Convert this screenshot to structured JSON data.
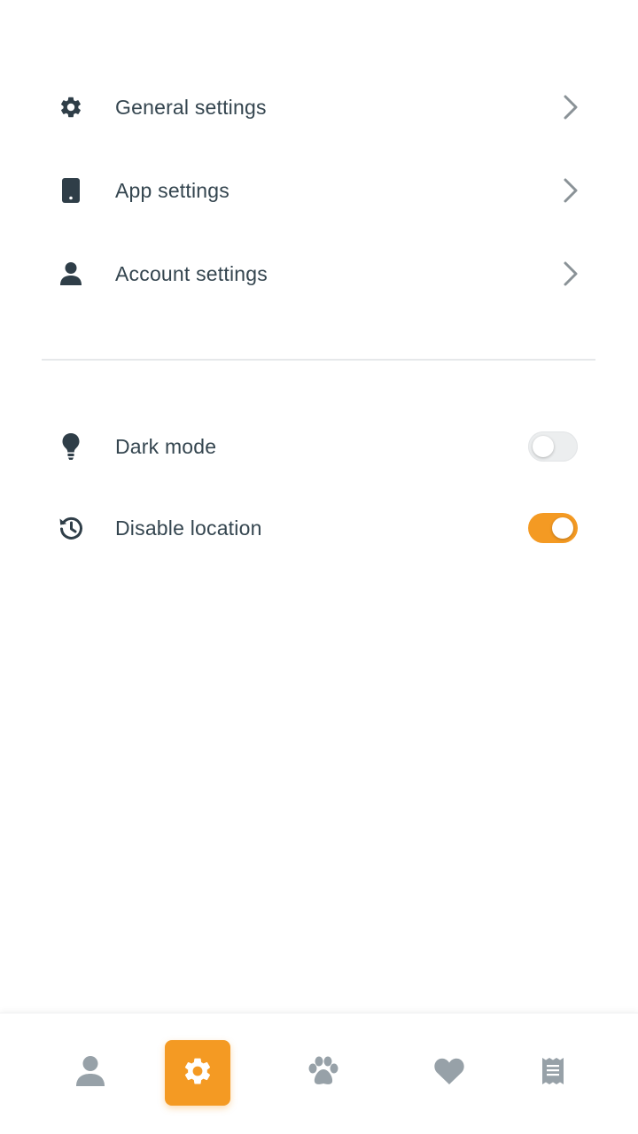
{
  "settings_menu": {
    "items": [
      {
        "label": "General settings",
        "icon": "gear-icon"
      },
      {
        "label": "App settings",
        "icon": "phone-icon"
      },
      {
        "label": "Account settings",
        "icon": "user-icon"
      }
    ]
  },
  "toggles": {
    "items": [
      {
        "label": "Dark mode",
        "icon": "lightbulb-icon",
        "enabled": false
      },
      {
        "label": "Disable location",
        "icon": "history-icon",
        "enabled": true
      }
    ]
  },
  "bottom_nav": {
    "tabs": [
      {
        "icon": "user-icon",
        "active": false
      },
      {
        "icon": "gear-icon",
        "active": true
      },
      {
        "icon": "paw-icon",
        "active": false
      },
      {
        "icon": "heart-icon",
        "active": false
      },
      {
        "icon": "receipt-icon",
        "active": false
      }
    ]
  },
  "colors": {
    "accent": "#f49a23",
    "text": "#34454f",
    "icon_dark": "#2f3e48",
    "icon_muted": "#97a1a8",
    "chevron": "#8a9297"
  }
}
